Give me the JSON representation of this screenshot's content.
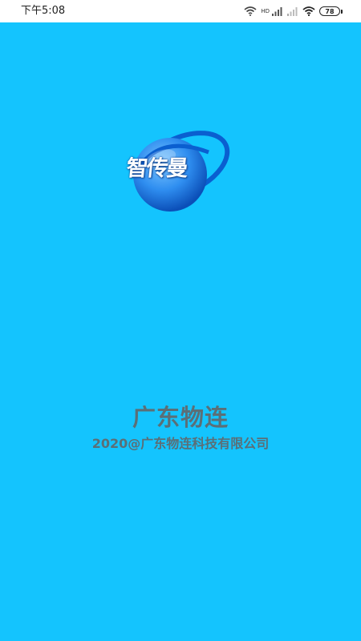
{
  "status_bar": {
    "time": "下午5:08",
    "network_label": "HD",
    "battery_level": "78"
  },
  "logo": {
    "text": "智传曼",
    "ring_color": "#0a5fd0",
    "sphere_color": "#2f8ef0"
  },
  "splash": {
    "background_color": "#14c4fe",
    "company_name": "广东物连",
    "copyright": "2020@广东物连科技有限公司"
  }
}
